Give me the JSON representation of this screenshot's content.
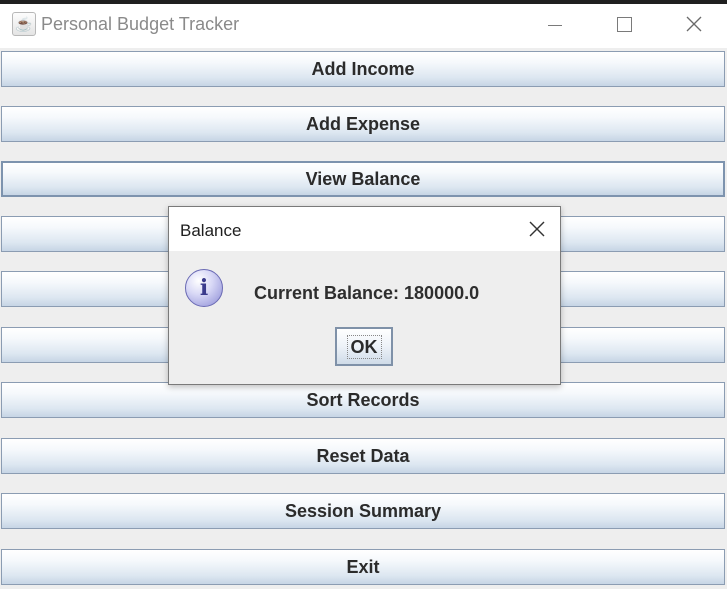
{
  "window": {
    "title": "Personal Budget Tracker",
    "icon": "java-cup-icon"
  },
  "menu_buttons": [
    {
      "label": "Add Income"
    },
    {
      "label": "Add Expense"
    },
    {
      "label": "View Balance"
    },
    {
      "label": ""
    },
    {
      "label": ""
    },
    {
      "label": ""
    },
    {
      "label": "Sort Records"
    },
    {
      "label": "Reset Data"
    },
    {
      "label": "Session Summary"
    },
    {
      "label": "Exit"
    }
  ],
  "dialog": {
    "title": "Balance",
    "icon": "info-icon",
    "message": "Current Balance: 180000.0",
    "ok_label": "OK"
  },
  "colors": {
    "button_border": "#8b9cb2",
    "button_gradient_bottom": "#c6d5e5",
    "info_icon": "#8a8ad4"
  }
}
